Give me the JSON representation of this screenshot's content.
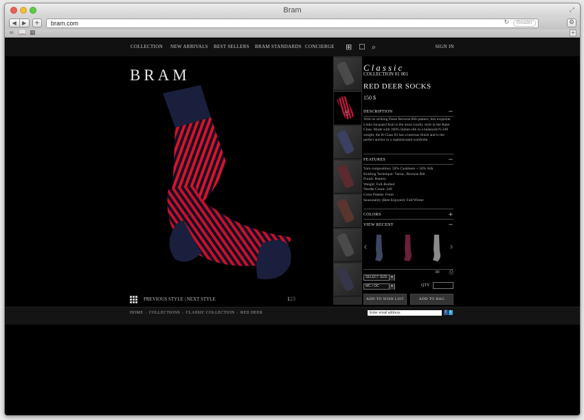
{
  "browser": {
    "title": "Bram",
    "url": "bram.com",
    "reader_label": "Reader",
    "back_icon": "◀",
    "forward_icon": "▶",
    "add_icon": "+",
    "refresh_icon": "↻",
    "gear_icon": "⚙",
    "resize_icon": "⤢",
    "glasses_icon": "∞",
    "book_icon": "📖",
    "grid_icon": "▦"
  },
  "nav": {
    "items": [
      "COLLECTION",
      "NEW ARRIVALS",
      "BEST SELLERS",
      "BRAM STANDARDS",
      "CONCIERGE"
    ],
    "signin": "SIGN IN",
    "gift_icon": "⊞",
    "bag_icon": "☐",
    "search_icon": "⌕"
  },
  "brand": {
    "logo": "BRAM"
  },
  "gallery": {
    "prev_next": "PREVIOUS STYLE | NEXT STYLE",
    "pages": [
      "1",
      "2",
      "3"
    ],
    "active_page": 1
  },
  "product": {
    "series": "Classic",
    "collection": "COLLECTION 01 001",
    "name": "RED DEER SOCKS",
    "price": "150 $",
    "description_title": "DESCRIPTION",
    "description": "With its striking Passe Reverse-Rib pattern, this exquisite Links-Jacquard Knit is the most courtly style in the Rake Class. Made with 100% Italian silk in a balanced N-240 weight, the R-Class 03 has a lustrous finish and is the perfect anchor to a sophisticated wardrobe.",
    "features_title": "FEATURES",
    "features": [
      "Yarn composition: 50% Cashmere + 50% Silk",
      "Knitting Technique: Variat , Reverse Rib",
      "Finish: Buttery",
      "Weight: Full-Bodied",
      "Needle Count: 240",
      "Color Palette: Fresh",
      "Seasonality (Best Enjoyed): Fall/Winter"
    ],
    "colors_title": "COLORS",
    "recent_title": "VIEW RECENT",
    "size_select": "SELECT SIZE",
    "fit_select": "MC / OC",
    "qty_label": "QTY",
    "wishlist_button": "ADD TO WISH LIST",
    "bag_button": "ADD TO BAG",
    "mail_icon": "✉",
    "print_icon": "⎙"
  },
  "footer": {
    "breadcrumb": [
      "HOME",
      "COLLECTIONS",
      "CLASSIC COLLECTION",
      "RED DEER"
    ],
    "email_placeholder": "Enter email address",
    "facebook": "f",
    "twitter": "t"
  },
  "colors": {
    "accent_red": "#d8132a",
    "navy": "#141a36",
    "background": "#000000"
  }
}
